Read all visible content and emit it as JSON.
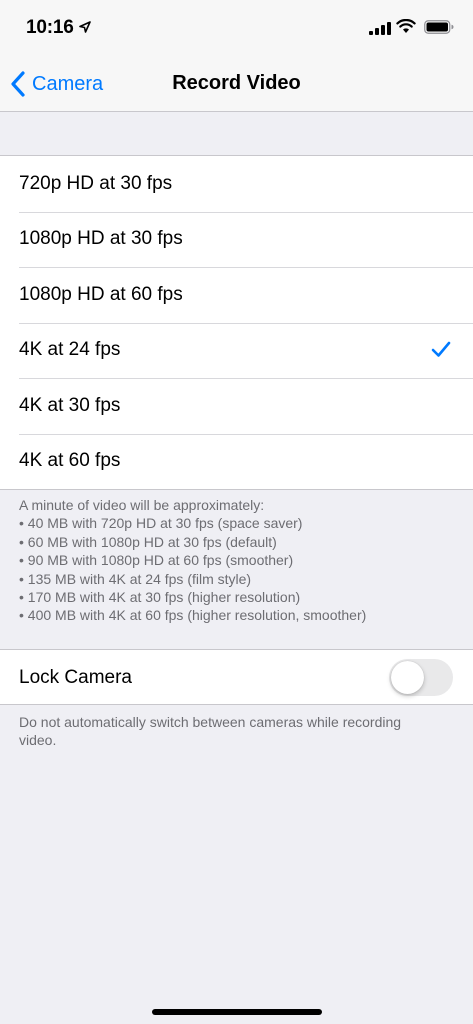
{
  "status_bar": {
    "time": "10:16",
    "icons": [
      "location-arrow-icon",
      "cellular-signal-icon",
      "wifi-icon",
      "battery-icon"
    ]
  },
  "nav": {
    "back_label": "Camera",
    "title": "Record Video"
  },
  "accent_color": "#007aff",
  "options": [
    {
      "label": "720p HD at 30 fps",
      "selected": false
    },
    {
      "label": "1080p HD at 30 fps",
      "selected": false
    },
    {
      "label": "1080p HD at 60 fps",
      "selected": false
    },
    {
      "label": "4K at 24 fps",
      "selected": true
    },
    {
      "label": "4K at 30 fps",
      "selected": false
    },
    {
      "label": "4K at 60 fps",
      "selected": false
    }
  ],
  "size_note": {
    "lines": [
      "A minute of video will be approximately:",
      "• 40 MB with 720p HD at 30 fps (space saver)",
      "• 60 MB with 1080p HD at 30 fps (default)",
      "• 90 MB with 1080p HD at 60 fps (smoother)",
      "• 135 MB with 4K at 24 fps (film style)",
      "• 170 MB with 4K at 30 fps (higher resolution)",
      "• 400 MB with 4K at 60 fps (higher resolution, smoother)"
    ]
  },
  "lock_camera": {
    "label": "Lock Camera",
    "enabled": false,
    "footnote": "Do not automatically switch between cameras while recording video."
  }
}
